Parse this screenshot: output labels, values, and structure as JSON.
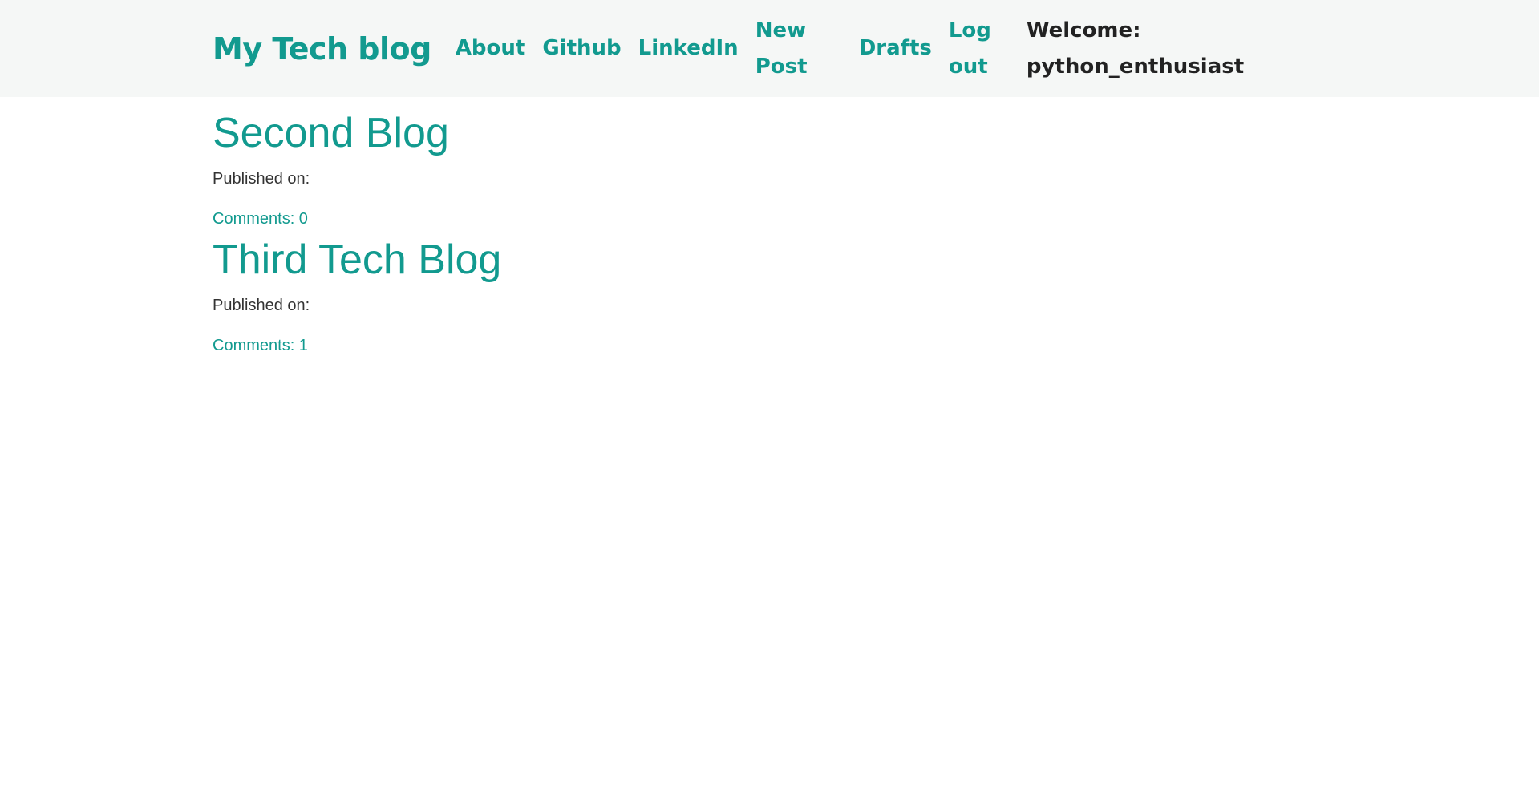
{
  "header": {
    "brand": "My Tech blog",
    "nav": [
      {
        "label": "About"
      },
      {
        "label": "Github"
      },
      {
        "label": "LinkedIn"
      },
      {
        "label": "New Post"
      },
      {
        "label": "Drafts"
      },
      {
        "label": "Log out"
      }
    ],
    "welcome": "Welcome: python_enthusiast"
  },
  "posts": [
    {
      "title": "Second Blog",
      "published": "Published on:",
      "comments": "Comments: 0"
    },
    {
      "title": "Third Tech Blog",
      "published": "Published on:",
      "comments": "Comments: 1"
    }
  ],
  "colors": {
    "accent": "#129a8f",
    "header_bg": "#f5f7f6",
    "text": "#333333",
    "welcome_text": "#222222"
  }
}
